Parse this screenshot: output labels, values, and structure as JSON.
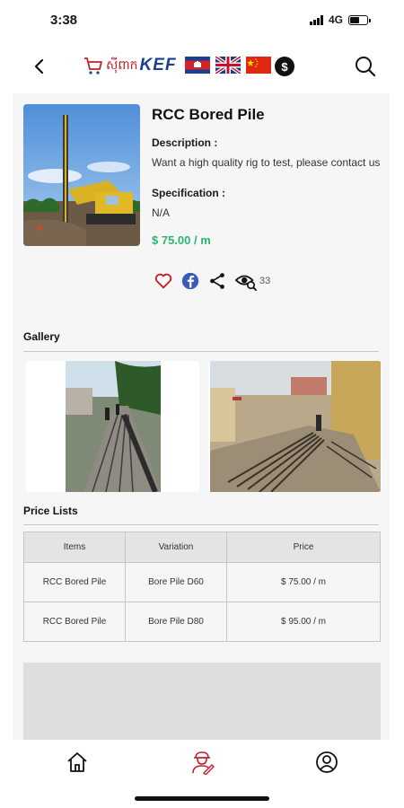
{
  "status_bar": {
    "time": "3:38",
    "network": "4G",
    "battery_level": 0.55
  },
  "header": {
    "logo_text_khmer": "ស៊ីពាក",
    "logo_text": "KEF",
    "languages": [
      "khmer-flag-icon",
      "uk-flag-icon",
      "china-flag-icon"
    ],
    "currency_symbol": "$"
  },
  "product": {
    "title": "RCC Bored Pile",
    "description_label": "Description :",
    "description": "Want a high quality rig to test, please contact us",
    "specification_label": "Specification :",
    "specification": "N/A",
    "price": "$ 75.00 / m",
    "view_count": "33"
  },
  "gallery": {
    "title": "Gallery"
  },
  "price_list": {
    "title": "Price Lists",
    "headers": [
      "Items",
      "Variation",
      "Price"
    ],
    "rows": [
      [
        "RCC Bored Pile",
        "Bore Pile D60",
        "$ 75.00 / m"
      ],
      [
        "RCC Bored Pile",
        "Bore Pile D80",
        "$ 95.00 / m"
      ]
    ]
  },
  "colors": {
    "price_green": "#2bb673",
    "favorite_red": "#c0202a",
    "facebook_blue": "#3b5bb8"
  },
  "bottom_nav": {
    "items": [
      "home-icon",
      "engineer-icon",
      "profile-icon"
    ]
  }
}
